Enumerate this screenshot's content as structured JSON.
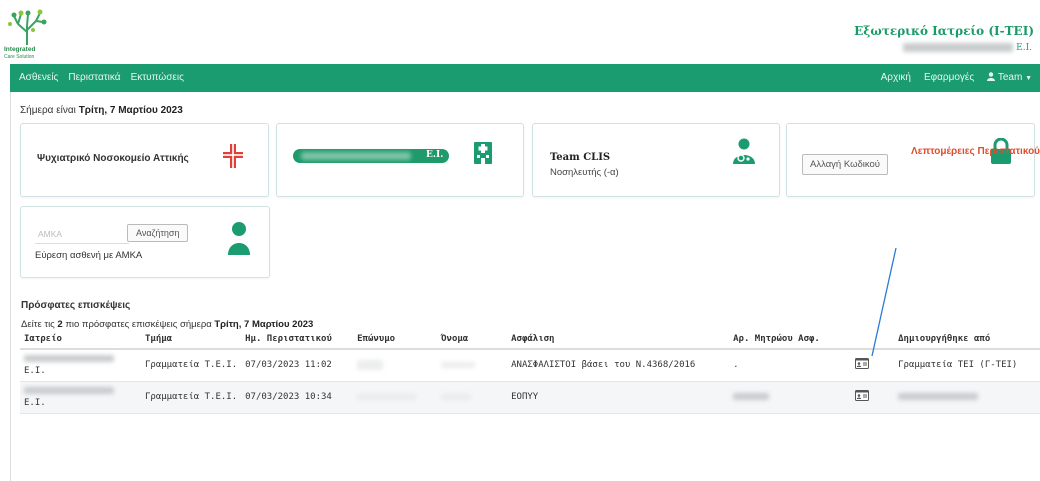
{
  "header": {
    "logo_line1": "Integrated",
    "logo_line2": "Care Solution",
    "clinic_title": "Εξωτερικό Ιατρείο (Ι-ΤΕΙ)",
    "clinic_sub_suffix": "Ε.Ι."
  },
  "nav": {
    "left": [
      "Ασθενείς",
      "Περιστατικά",
      "Εκτυπώσεις"
    ],
    "right": [
      "Αρχική",
      "Εφαρμογές"
    ],
    "user": "Team"
  },
  "today": {
    "prefix": "Σήμερα είναι",
    "date": "Τρίτη, 7 Μαρτίου 2023"
  },
  "cards": {
    "hospital": "Ψυχιατρικό Νοσοκομείο Αττικής",
    "unit_suffix": "Ε.Ι.",
    "user_name": "Team CLIS",
    "user_role": "Νοσηλευτής (-α)",
    "change_password": "Αλλαγή Κωδικού",
    "amka_placeholder": "ΑΜΚΑ",
    "search_button": "Αναζήτηση",
    "search_caption": "Εύρεση ασθενή με ΑΜΚΑ"
  },
  "recent": {
    "title": "Πρόσφατες επισκέψεις",
    "sub_prefix": "Δείτε τις",
    "count": "2",
    "sub_middle": "πιο πρόσφατες επισκέψεις σήμερα",
    "sub_date": "Τρίτη, 7 Μαρτίου 2023",
    "columns": [
      "Ιατρείο",
      "Τμήμα",
      "Ημ. Περιστατικού",
      "Επώνυμο",
      "Όνομα",
      "Ασφάλιση",
      "Αρ. Μητρώου Ασφ.",
      "",
      "Δημιουργήθηκε από"
    ],
    "rows": [
      {
        "clinic_suffix": "Ε.Ι.",
        "department": "Γραμματεία Τ.Ε.Ι.",
        "date": "07/03/2023 11:02",
        "insurance": "ΑΝΑΣΦΑΛΙΣΤΟΙ βάσει του Ν.4368/2016",
        "reg_no": ".",
        "created_by": "Γραμματεία ΤΕΙ (Γ-ΤΕΙ)"
      },
      {
        "clinic_suffix": "Ε.Ι.",
        "department": "Γραμματεία Τ.Ε.Ι.",
        "date": "07/03/2023 10:34",
        "insurance": "ΕΟΠΥΥ",
        "reg_no": "",
        "created_by": ""
      }
    ]
  },
  "annotation": "Λεπτομέρειες Περιστατικού",
  "colors": {
    "primary": "#1a9b70",
    "annotation": "#e04c2c",
    "hospital_cross": "#e0403a",
    "annotation_line": "#2a7bd4"
  }
}
